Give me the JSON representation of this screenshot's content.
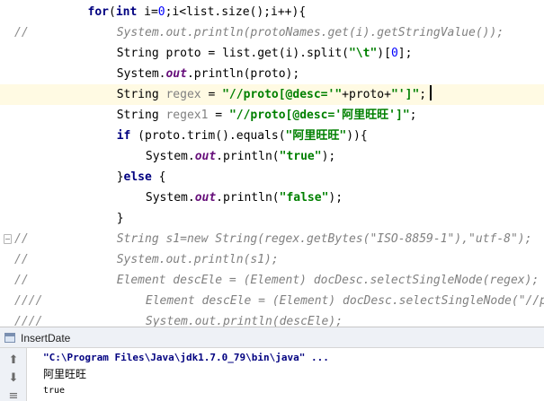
{
  "editor": {
    "lines": [
      {
        "gutter": "",
        "indent": 5,
        "tokens": [
          {
            "t": "for",
            "c": "kw"
          },
          {
            "t": "(",
            "c": "plain"
          },
          {
            "t": "int",
            "c": "kw"
          },
          {
            "t": " i=",
            "c": "plain"
          },
          {
            "t": "0",
            "c": "num"
          },
          {
            "t": ";i<list.size();i++){",
            "c": "plain"
          }
        ]
      },
      {
        "gutter": "//",
        "indent": 7,
        "tokens": [
          {
            "t": "System.out.println(protoNames.get(i).getStringValue());",
            "c": "cmt"
          }
        ]
      },
      {
        "gutter": "",
        "indent": 7,
        "tokens": [
          {
            "t": "String proto = list.get(i).split(",
            "c": "plain"
          },
          {
            "t": "\"\\t\"",
            "c": "str"
          },
          {
            "t": ")[",
            "c": "plain"
          },
          {
            "t": "0",
            "c": "num"
          },
          {
            "t": "];",
            "c": "plain"
          }
        ]
      },
      {
        "gutter": "",
        "indent": 7,
        "tokens": [
          {
            "t": "System.",
            "c": "plain"
          },
          {
            "t": "out",
            "c": "field"
          },
          {
            "t": ".println(proto);",
            "c": "plain"
          }
        ]
      },
      {
        "gutter": "",
        "indent": 7,
        "current": true,
        "caret": true,
        "tokens": [
          {
            "t": "String ",
            "c": "plain"
          },
          {
            "t": "regex",
            "c": "unused"
          },
          {
            "t": " = ",
            "c": "plain"
          },
          {
            "t": "\"//proto[@desc='\"",
            "c": "str"
          },
          {
            "t": "+proto+",
            "c": "plain"
          },
          {
            "t": "\"']\"",
            "c": "str"
          },
          {
            "t": ";",
            "c": "plain"
          }
        ]
      },
      {
        "gutter": "",
        "indent": 7,
        "tokens": [
          {
            "t": "String ",
            "c": "plain"
          },
          {
            "t": "regex1",
            "c": "unused"
          },
          {
            "t": " = ",
            "c": "plain"
          },
          {
            "t": "\"//proto[@desc='阿里旺旺']\"",
            "c": "str"
          },
          {
            "t": ";",
            "c": "plain"
          }
        ]
      },
      {
        "gutter": "",
        "indent": 7,
        "tokens": [
          {
            "t": "if",
            "c": "kw"
          },
          {
            "t": " (proto.trim().equals(",
            "c": "plain"
          },
          {
            "t": "\"阿里旺旺\"",
            "c": "str"
          },
          {
            "t": ")){",
            "c": "plain"
          }
        ]
      },
      {
        "gutter": "",
        "indent": 9,
        "tokens": [
          {
            "t": "System.",
            "c": "plain"
          },
          {
            "t": "out",
            "c": "field"
          },
          {
            "t": ".println(",
            "c": "plain"
          },
          {
            "t": "\"true\"",
            "c": "str"
          },
          {
            "t": ");",
            "c": "plain"
          }
        ]
      },
      {
        "gutter": "",
        "indent": 7,
        "tokens": [
          {
            "t": "}",
            "c": "plain"
          },
          {
            "t": "else",
            "c": "kw"
          },
          {
            "t": " {",
            "c": "plain"
          }
        ]
      },
      {
        "gutter": "",
        "indent": 9,
        "tokens": [
          {
            "t": "System.",
            "c": "plain"
          },
          {
            "t": "out",
            "c": "field"
          },
          {
            "t": ".println(",
            "c": "plain"
          },
          {
            "t": "\"false\"",
            "c": "str"
          },
          {
            "t": ");",
            "c": "plain"
          }
        ]
      },
      {
        "gutter": "",
        "indent": 7,
        "tokens": [
          {
            "t": "}",
            "c": "plain"
          }
        ]
      },
      {
        "gutter": "//",
        "fold": true,
        "indent": 7,
        "tokens": [
          {
            "t": "String s1=new String(regex.getBytes(\"ISO-8859-1\"),\"utf-8\");",
            "c": "cmt"
          }
        ]
      },
      {
        "gutter": "//",
        "indent": 7,
        "tokens": [
          {
            "t": "System.out.println(s1);",
            "c": "cmt"
          }
        ]
      },
      {
        "gutter": "//",
        "indent": 7,
        "tokens": [
          {
            "t": "Element descEle = (Element) docDesc.selectSingleNode(regex);",
            "c": "cmt"
          }
        ]
      },
      {
        "gutter": "////",
        "indent": 9,
        "tokens": [
          {
            "t": "Element descEle = (Element) docDesc.selectSingleNode(\"//pr",
            "c": "cmt"
          }
        ]
      },
      {
        "gutter": "////",
        "indent": 9,
        "tokens": [
          {
            "t": "System.out.println(descEle);",
            "c": "cmt"
          }
        ]
      }
    ]
  },
  "run_panel": {
    "tab_label": "InsertDate",
    "tab_icon": "run-config-icon",
    "toolbar": [
      {
        "name": "scroll-up-arrow-icon",
        "glyph": "⬆"
      },
      {
        "name": "scroll-down-arrow-icon",
        "glyph": "⬇"
      },
      {
        "name": "soft-wrap-icon",
        "glyph": "≡"
      }
    ],
    "output": [
      {
        "text": "\"C:\\Program Files\\Java\\jdk1.7.0_79\\bin\\java\" ...",
        "kind": "cmd"
      },
      {
        "text": "阿里旺旺",
        "kind": "out"
      },
      {
        "text": "true",
        "kind": "out-small"
      }
    ]
  }
}
